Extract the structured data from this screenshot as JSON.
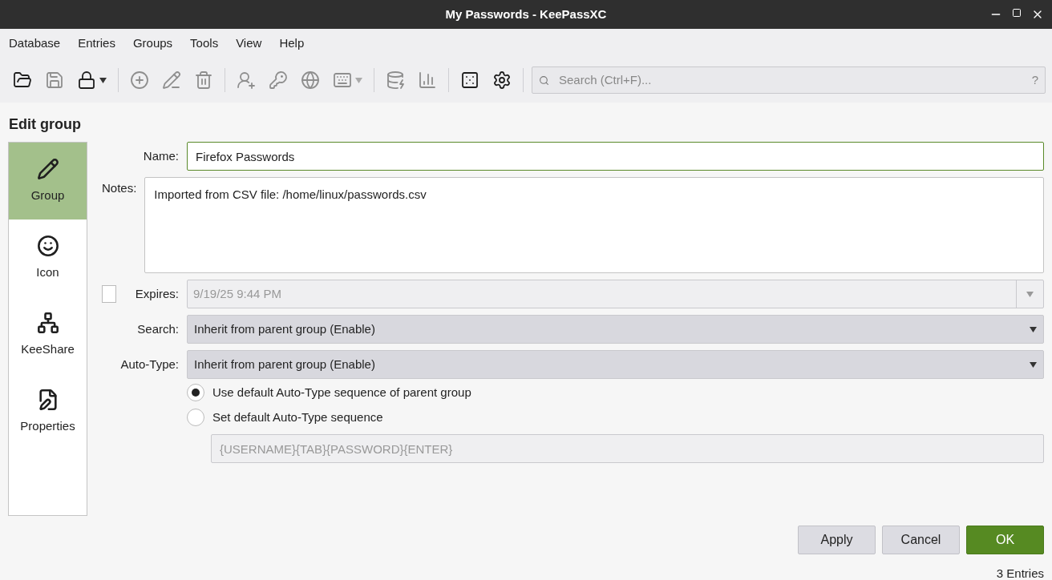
{
  "window": {
    "title": "My Passwords - KeePassXC"
  },
  "menu": [
    "Database",
    "Entries",
    "Groups",
    "Tools",
    "View",
    "Help"
  ],
  "toolbar": [
    {
      "kind": "button",
      "disabled": false
    },
    {
      "kind": "button",
      "disabled": true
    },
    {
      "kind": "dropdown",
      "disabled": false
    },
    {
      "kind": "separator"
    },
    {
      "kind": "button",
      "disabled": true
    },
    {
      "kind": "button",
      "disabled": true
    },
    {
      "kind": "button",
      "disabled": true
    },
    {
      "kind": "separator"
    },
    {
      "kind": "button",
      "disabled": true
    },
    {
      "kind": "button",
      "disabled": true
    },
    {
      "kind": "button",
      "disabled": true
    },
    {
      "kind": "dropdown",
      "disabled": true
    },
    {
      "kind": "separator"
    },
    {
      "kind": "button",
      "disabled": true
    },
    {
      "kind": "button",
      "disabled": true
    },
    {
      "kind": "separator"
    },
    {
      "kind": "button",
      "disabled": false
    },
    {
      "kind": "button",
      "disabled": false
    },
    {
      "kind": "separator"
    }
  ],
  "search": {
    "placeholder": "Search (Ctrl+F)...",
    "help": "?"
  },
  "heading": "Edit group",
  "sidebar": {
    "items": [
      {
        "label": "Group",
        "selected": true
      },
      {
        "label": "Icon",
        "selected": false
      },
      {
        "label": "KeeShare",
        "selected": false
      },
      {
        "label": "Properties",
        "selected": false
      }
    ]
  },
  "form": {
    "name": {
      "label": "Name:",
      "value": "Firefox Passwords"
    },
    "notes": {
      "label": "Notes:",
      "value": "Imported from CSV file: /home/linux/passwords.csv"
    },
    "expires": {
      "label": "Expires:",
      "checked": false,
      "value": "9/19/25 9:44 PM"
    },
    "search": {
      "label": "Search:",
      "value": "Inherit from parent group (Enable)"
    },
    "auto_type": {
      "label": "Auto-Type:",
      "value": "Inherit from parent group (Enable)"
    },
    "radios": [
      {
        "label": "Use default Auto-Type sequence of parent group",
        "selected": true
      },
      {
        "label": "Set default Auto-Type sequence",
        "selected": false
      }
    ],
    "sequence": {
      "value": "{USERNAME}{TAB}{PASSWORD}{ENTER}",
      "disabled": true
    }
  },
  "buttons": [
    {
      "label": "Apply",
      "kind": "normal"
    },
    {
      "label": "Cancel",
      "kind": "normal"
    },
    {
      "label": "OK",
      "kind": "primary"
    }
  ],
  "status_bar": "3 Entries"
}
